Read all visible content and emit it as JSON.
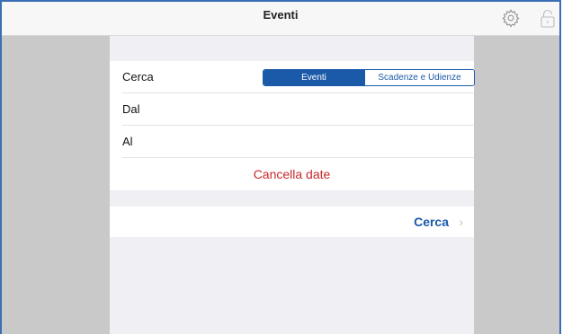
{
  "navbar": {
    "title": "Eventi",
    "gear_icon": "gear-icon",
    "lock_icon": "lock-icon"
  },
  "search_row": {
    "label": "Cerca",
    "segments": [
      {
        "label": "Eventi",
        "selected": true
      },
      {
        "label": "Scadenze e Udienze",
        "selected": false
      }
    ]
  },
  "from_row": {
    "label": "Dal"
  },
  "to_row": {
    "label": "Al"
  },
  "clear_dates_label": "Cancella date",
  "search_button": {
    "label": "Cerca",
    "chevron": "›"
  },
  "colors": {
    "accent": "#1a5aa8",
    "destructive": "#c8282c",
    "side_panel": "#c9c9c9"
  }
}
